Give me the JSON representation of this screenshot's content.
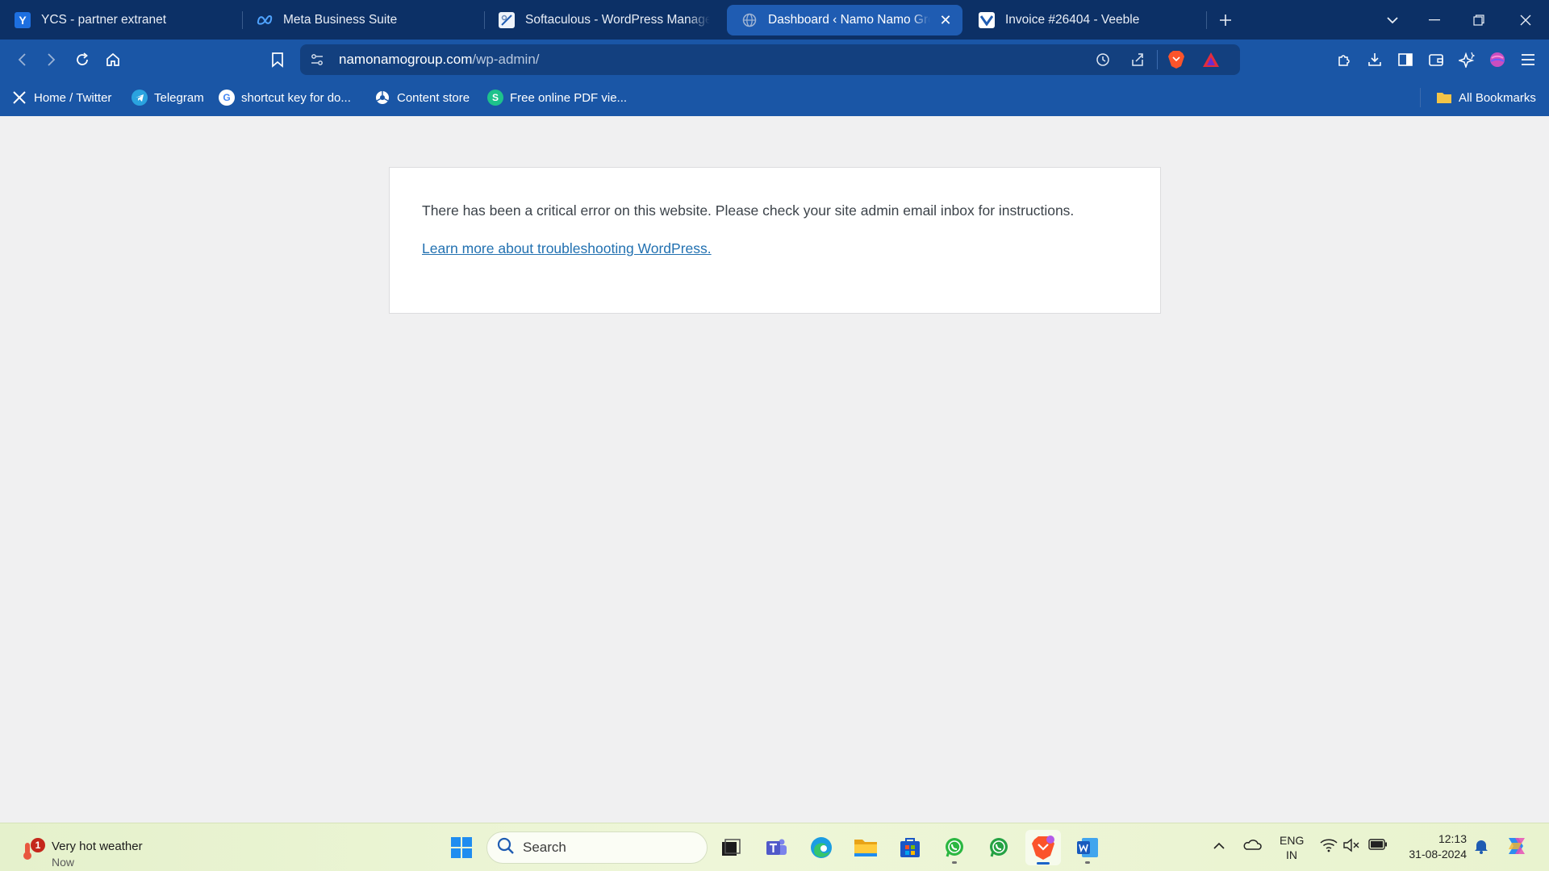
{
  "tabs": [
    {
      "title": "YCS - partner extranet",
      "icon": "ycs-favicon",
      "active": false
    },
    {
      "title": "Meta Business Suite",
      "icon": "meta-favicon",
      "active": false
    },
    {
      "title": "Softaculous - WordPress Manageme",
      "icon": "softaculous-favicon",
      "active": false
    },
    {
      "title": "Dashboard ‹ Namo Namo Grou",
      "icon": "globe-favicon",
      "active": true
    },
    {
      "title": "Invoice #26404 - Veeble",
      "icon": "veeble-favicon",
      "active": false
    }
  ],
  "address_bar": {
    "domain": "namonamogroup.com",
    "path": "/wp-admin/"
  },
  "bookmarks": [
    {
      "label": "Home / Twitter",
      "icon": "x-icon"
    },
    {
      "label": "Telegram",
      "icon": "telegram-icon"
    },
    {
      "label": "shortcut key for do...",
      "icon": "google-icon"
    },
    {
      "label": "Content store",
      "icon": "chrome-web-store-icon"
    },
    {
      "label": "Free online PDF vie...",
      "icon": "s-icon"
    }
  ],
  "all_bookmarks_label": "All Bookmarks",
  "page": {
    "error_message": "There has been a critical error on this website. Please check your site admin email inbox for instructions.",
    "link_text": "Learn more about troubleshooting WordPress."
  },
  "taskbar": {
    "weather_title": "Very hot weather",
    "weather_subtitle": "Now",
    "weather_badge": "1",
    "search_label": "Search",
    "language_top": "ENG",
    "language_bottom": "IN",
    "time": "12:13",
    "date": "31-08-2024"
  },
  "colors": {
    "tabstrip": "#0c3066",
    "toolbar": "#1a56a6",
    "active_tab": "#1f5cb2",
    "page_background": "#f0f0f1",
    "link": "#2271b1"
  }
}
